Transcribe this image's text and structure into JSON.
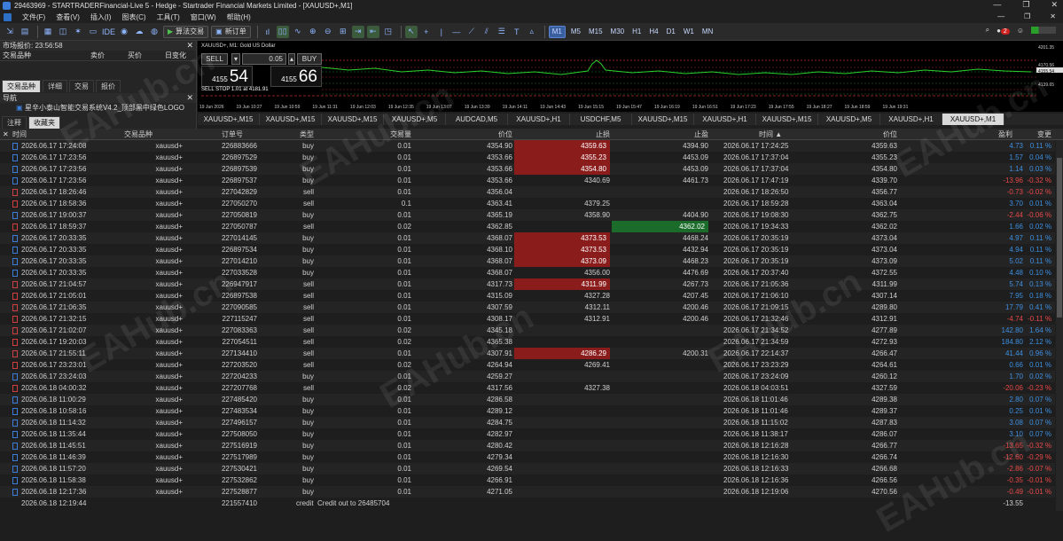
{
  "window": {
    "title": "29463969 - STARTRADERFinancial-Live 5 - Hedge - Startrader Financial Markets Limited - [XAUUSD+,M1]"
  },
  "menu": [
    "文件(F)",
    "查看(V)",
    "插入(I)",
    "图表(C)",
    "工具(T)",
    "窗口(W)",
    "帮助(H)"
  ],
  "toolbar": {
    "algo_label": "算法交易",
    "new_order_label": "新订单",
    "timeframes": [
      "M1",
      "M5",
      "M15",
      "M30",
      "H1",
      "H4",
      "D1",
      "W1",
      "MN"
    ],
    "active_timeframe": "M1",
    "notif_count": "2"
  },
  "market_watch": {
    "title": "市场报价: 23:56:58",
    "columns": [
      "交易品种",
      "卖价",
      "买价",
      "日变化"
    ],
    "tabs": [
      "交易品种",
      "详细",
      "交易",
      "报价"
    ],
    "active_tab": "交易品种"
  },
  "navigator": {
    "title": "导航",
    "item": "星辛小泰山智能交易系统V4.2_顶部黑中绿色LOGO",
    "tabs": [
      "注释",
      "收藏夹"
    ],
    "active_tab": "收藏夹"
  },
  "chart": {
    "header": "XAUUSD+, M1:  Gold US Dollar",
    "sell_label": "SELL",
    "buy_label": "BUY",
    "lot": "0.05",
    "sell_price_small": "4155",
    "sell_price_big": "54",
    "buy_price_small": "4155",
    "buy_price_big": "66",
    "sell_stop": "SELL STOP 1.01 at 4181.91",
    "y_labels": [
      "4201.35",
      "4170.56",
      "4155.54",
      "4139.65"
    ],
    "x_labels": [
      "19 Jun 2026",
      "19 Jun 10:27",
      "19 Jun 10:59",
      "19 Jun 11:31",
      "19 Jun 12:03",
      "19 Jun 12:35",
      "19 Jun 13:07",
      "19 Jun 13:39",
      "19 Jun 14:11",
      "19 Jun 14:43",
      "19 Jun 15:15",
      "19 Jun 15:47",
      "19 Jun 16:19",
      "19 Jun 16:51",
      "19 Jun 17:23",
      "19 Jun 17:55",
      "19 Jun 18:27",
      "19 Jun 18:59",
      "19 Jun 19:31"
    ]
  },
  "chart_tabs": [
    "XAUUSD+,M15",
    "XAUUSD+,M15",
    "XAUUSD+,M15",
    "XAUUSD+,M5",
    "AUDCAD,M5",
    "XAUUSD+,H1",
    "USDCHF,M5",
    "XAUUSD+,M15",
    "XAUUSD+,H1",
    "XAUUSD+,M15",
    "XAUUSD+,M5",
    "XAUUSD+,H1",
    "XAUUSD+,M1"
  ],
  "active_chart_tab": 12,
  "table": {
    "headers": [
      "时间",
      "交易品种",
      "订单号",
      "类型",
      "交易量",
      "价位",
      "止损",
      "止盈",
      "时间",
      "价位",
      "盈利",
      "变更"
    ],
    "rows": [
      [
        "2026.06.17 17:24:08",
        "xauusd+",
        "226883666",
        "buy",
        "0.01",
        "4354.90",
        "4359.63",
        "4394.90",
        "2026.06.17 17:24:25",
        "4359.63",
        "4.73",
        "0.11 %"
      ],
      [
        "2026.06.17 17:23:56",
        "xauusd+",
        "226897529",
        "buy",
        "0.01",
        "4353.66",
        "4355.23",
        "4453.09",
        "2026.06.17 17:37:04",
        "4355.23",
        "1.57",
        "0.04 %"
      ],
      [
        "2026.06.17 17:23:56",
        "xauusd+",
        "226897539",
        "buy",
        "0.01",
        "4353.66",
        "4354.80",
        "4453.09",
        "2026.06.17 17:37:04",
        "4354.80",
        "1.14",
        "0.03 %"
      ],
      [
        "2026.06.17 17:23:56",
        "xauusd+",
        "226897537",
        "buy",
        "0.01",
        "4353.66",
        "4340.69",
        "4461.73",
        "2026.06.17 17:47:19",
        "4339.70",
        "-13.96",
        "-0.32 %"
      ],
      [
        "2026.06.17 18:26:46",
        "xauusd+",
        "227042829",
        "sell",
        "0.01",
        "4356.04",
        "",
        "",
        "2026.06.17 18:26:50",
        "4356.77",
        "-0.73",
        "-0.02 %"
      ],
      [
        "2026.06.17 18:58:36",
        "xauusd+",
        "227050270",
        "sell",
        "0.1",
        "4363.41",
        "4379.25",
        "",
        "2026.06.17 18:59:28",
        "4363.04",
        "3.70",
        "0.01 %"
      ],
      [
        "2026.06.17 19:00:37",
        "xauusd+",
        "227050819",
        "buy",
        "0.01",
        "4365.19",
        "4358.90",
        "4404.90",
        "2026.06.17 19:08:30",
        "4362.75",
        "-2.44",
        "-0.06 %"
      ],
      [
        "2026.06.17 18:59:37",
        "xauusd+",
        "227050787",
        "sell",
        "0.02",
        "4362.85",
        "",
        "4362.02",
        "2026.06.17 19:34:33",
        "4362.02",
        "1.66",
        "0.02 %"
      ],
      [
        "2026.06.17 20:33:35",
        "xauusd+",
        "227014145",
        "buy",
        "0.01",
        "4368.07",
        "4373.53",
        "4468.24",
        "2026.06.17 20:35:19",
        "4373.04",
        "4.97",
        "0.11 %"
      ],
      [
        "2026.06.17 20:33:35",
        "xauusd+",
        "226897534",
        "buy",
        "0.01",
        "4368.10",
        "4373.53",
        "4432.94",
        "2026.06.17 20:35:19",
        "4373.04",
        "4.94",
        "0.11 %"
      ],
      [
        "2026.06.17 20:33:35",
        "xauusd+",
        "227014210",
        "buy",
        "0.01",
        "4368.07",
        "4373.09",
        "4468.23",
        "2026.06.17 20:35:19",
        "4373.09",
        "5.02",
        "0.11 %"
      ],
      [
        "2026.06.17 20:33:35",
        "xauusd+",
        "227033528",
        "buy",
        "0.01",
        "4368.07",
        "4356.00",
        "4476.69",
        "2026.06.17 20:37:40",
        "4372.55",
        "4.48",
        "0.10 %"
      ],
      [
        "2026.06.17 21:04:57",
        "xauusd+",
        "226947917",
        "sell",
        "0.01",
        "4317.73",
        "4311.99",
        "4267.73",
        "2026.06.17 21:05:36",
        "4311.99",
        "5.74",
        "0.13 %"
      ],
      [
        "2026.06.17 21:05:01",
        "xauusd+",
        "226897538",
        "sell",
        "0.01",
        "4315.09",
        "4327.28",
        "4207.45",
        "2026.06.17 21:06:10",
        "4307.14",
        "7.95",
        "0.18 %"
      ],
      [
        "2026.06.17 21:06:35",
        "xauusd+",
        "227090585",
        "sell",
        "0.01",
        "4307.59",
        "4312.11",
        "4200.46",
        "2026.06.17 21:09:15",
        "4289.80",
        "17.79",
        "0.41 %"
      ],
      [
        "2026.06.17 21:32:15",
        "xauusd+",
        "227115247",
        "sell",
        "0.01",
        "4308.17",
        "4312.91",
        "4200.46",
        "2026.06.17 21:32:46",
        "4312.91",
        "-4.74",
        "-0.11 %"
      ],
      [
        "2026.06.17 21:02:07",
        "xauusd+",
        "227083363",
        "sell",
        "0.02",
        "4345.18",
        "",
        "",
        "2026.06.17 21:34:52",
        "4277.89",
        "142.80",
        "1.64 %"
      ],
      [
        "2026.06.17 19:20:03",
        "xauusd+",
        "227054511",
        "sell",
        "0.02",
        "4365.38",
        "",
        "",
        "2026.06.17 21:34:59",
        "4272.93",
        "184.80",
        "2.12 %"
      ],
      [
        "2026.06.17 21:55:11",
        "xauusd+",
        "227134410",
        "sell",
        "0.01",
        "4307.91",
        "4286.29",
        "4200.31",
        "2026.06.17 22:14:37",
        "4266.47",
        "41.44",
        "0.96 %"
      ],
      [
        "2026.06.17 23:23:01",
        "xauusd+",
        "227203520",
        "sell",
        "0.02",
        "4264.94",
        "4269.41",
        "",
        "2026.06.17 23:23:29",
        "4264.61",
        "0.66",
        "0.01 %"
      ],
      [
        "2026.06.17 23:24:03",
        "xauusd+",
        "227204233",
        "buy",
        "0.01",
        "4259.27",
        "",
        "",
        "2026.06.17 23:24:09",
        "4260.12",
        "1.70",
        "0.02 %"
      ],
      [
        "2026.06.18 04:00:32",
        "xauusd+",
        "227207768",
        "sell",
        "0.02",
        "4317.56",
        "4327.38",
        "",
        "2026.06.18 04:03:51",
        "4327.59",
        "-20.06",
        "-0.23 %"
      ],
      [
        "2026.06.18 11:00:29",
        "xauusd+",
        "227485420",
        "buy",
        "0.01",
        "4286.58",
        "",
        "",
        "2026.06.18 11:01:46",
        "4289.38",
        "2.80",
        "0.07 %"
      ],
      [
        "2026.06.18 10:58:16",
        "xauusd+",
        "227483534",
        "buy",
        "0.01",
        "4289.12",
        "",
        "",
        "2026.06.18 11:01:46",
        "4289.37",
        "0.25",
        "0.01 %"
      ],
      [
        "2026.06.18 11:14:32",
        "xauusd+",
        "227496157",
        "buy",
        "0.01",
        "4284.75",
        "",
        "",
        "2026.06.18 11:15:02",
        "4287.83",
        "3.08",
        "0.07 %"
      ],
      [
        "2026.06.18 11:35:44",
        "xauusd+",
        "227508050",
        "buy",
        "0.01",
        "4282.97",
        "",
        "",
        "2026.06.18 11:38:17",
        "4286.07",
        "3.10",
        "0.07 %"
      ],
      [
        "2026.06.18 11:45:51",
        "xauusd+",
        "227516919",
        "buy",
        "0.01",
        "4280.42",
        "",
        "",
        "2026.06.18 12:16:28",
        "4266.77",
        "-13.65",
        "-0.32 %"
      ],
      [
        "2026.06.18 11:46:39",
        "xauusd+",
        "227517989",
        "buy",
        "0.01",
        "4279.34",
        "",
        "",
        "2026.06.18 12:16:30",
        "4266.74",
        "-12.60",
        "-0.29 %"
      ],
      [
        "2026.06.18 11:57:20",
        "xauusd+",
        "227530421",
        "buy",
        "0.01",
        "4269.54",
        "",
        "",
        "2026.06.18 12:16:33",
        "4266.68",
        "-2.86",
        "-0.07 %"
      ],
      [
        "2026.06.18 11:58:38",
        "xauusd+",
        "227532862",
        "buy",
        "0.01",
        "4266.91",
        "",
        "",
        "2026.06.18 12:16:36",
        "4266.56",
        "-0.35",
        "-0.01 %"
      ],
      [
        "2026.06.18 12:17:36",
        "xauusd+",
        "227528877",
        "buy",
        "0.01",
        "4271.05",
        "",
        "",
        "2026.06.18 12:19:06",
        "4270.56",
        "-0.49",
        "-0.01 %"
      ]
    ],
    "last_row": {
      "time": "2026.06.18 12:19:44",
      "order": "221557410",
      "type": "credit",
      "comment": "Credit out to 26485704",
      "profit": "-13.55"
    }
  },
  "watermark": "EAHub.cn"
}
